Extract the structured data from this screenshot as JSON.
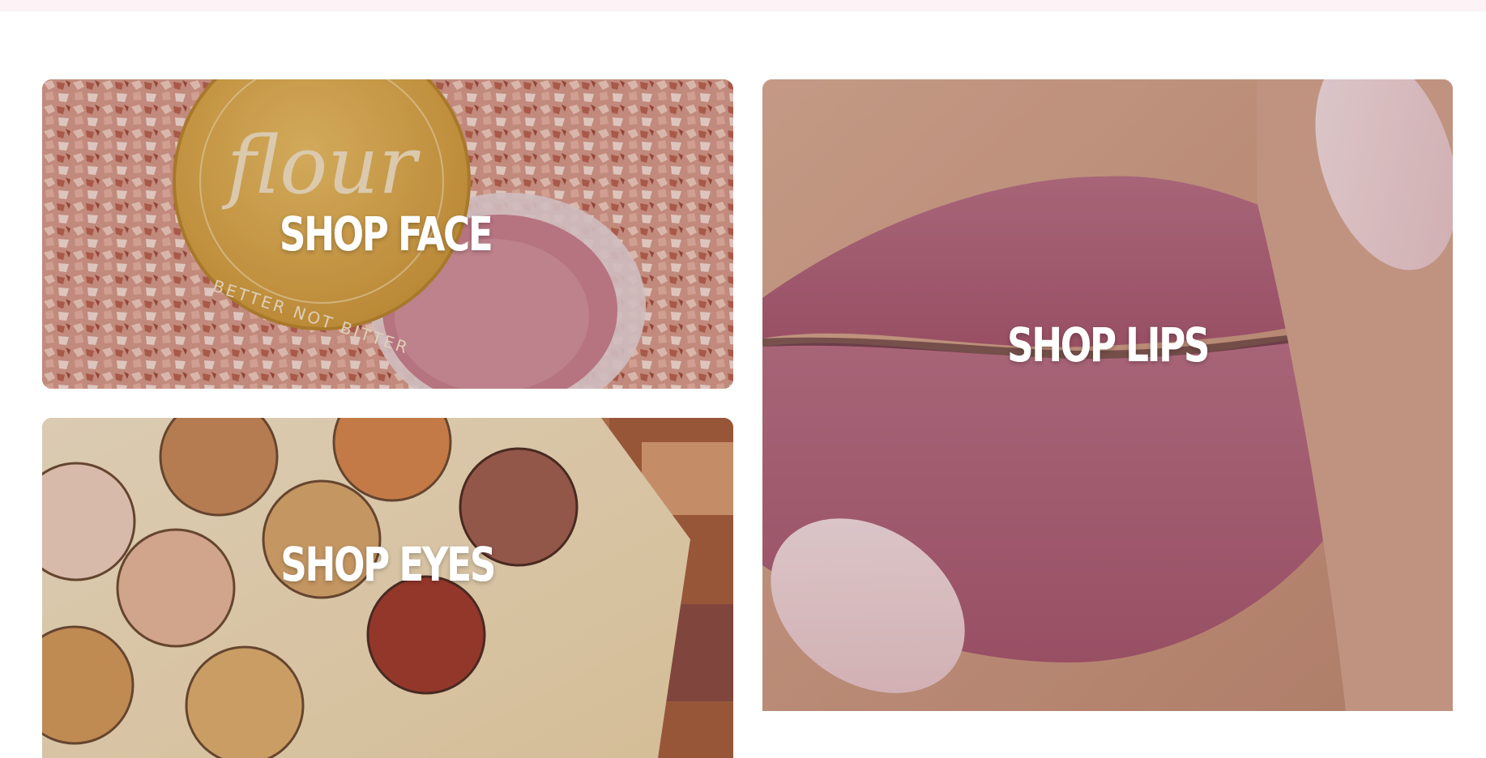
{
  "colors": {
    "topbar": "#fdf2f5",
    "background": "#ffffff",
    "label": "#ffffff"
  },
  "tiles": {
    "face": {
      "label": "SHOP FACE"
    },
    "eyes": {
      "label": "SHOP EYES"
    },
    "lips": {
      "label": "SHOP LIPS"
    }
  }
}
